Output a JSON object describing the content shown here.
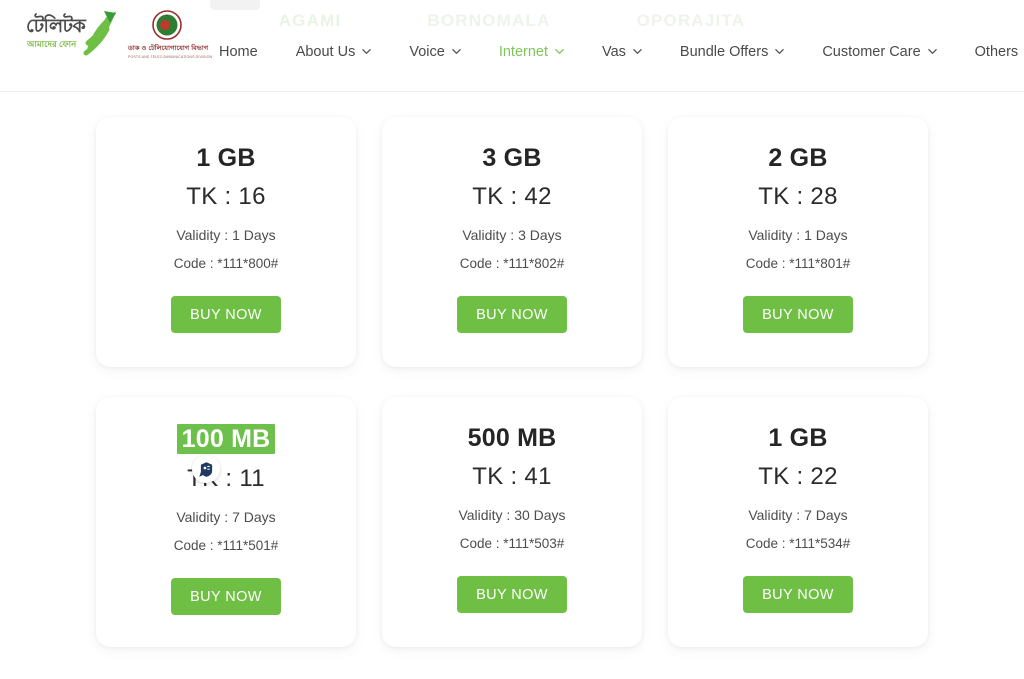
{
  "header": {
    "logo": {
      "brand_name_bn": "টেলিটক",
      "brand_tagline_bn": "আমাদের ফোন",
      "brand_icon": "teletalk-swoosh-icon"
    },
    "gov_logo": {
      "seal_icon": "bangladesh-government-seal-icon",
      "department_bn": "ডাক ও টেলিযোগাযোগ বিভাগ",
      "department_en": "POSTS AND TELECOMMUNICATIONS DIVISION"
    },
    "watermark": [
      "AGAMI",
      "BORNOMALA",
      "OPORAJITA"
    ],
    "nav": [
      {
        "label": "Home",
        "has_caret": false,
        "active": false
      },
      {
        "label": "About Us",
        "has_caret": true,
        "active": false
      },
      {
        "label": "Voice",
        "has_caret": true,
        "active": false
      },
      {
        "label": "Internet",
        "has_caret": true,
        "active": true
      },
      {
        "label": "Vas",
        "has_caret": true,
        "active": false
      },
      {
        "label": "Bundle Offers",
        "has_caret": true,
        "active": false
      },
      {
        "label": "Customer Care",
        "has_caret": true,
        "active": false
      },
      {
        "label": "Others",
        "has_caret": true,
        "active": false
      }
    ]
  },
  "colors": {
    "accent_green": "#6fbf44",
    "active_nav_green": "#7fc55b",
    "selection_green": "#6ec04c",
    "badge_navy": "#1f3864",
    "text_dark": "#252525",
    "card_bg": "#ffffff"
  },
  "packages": [
    {
      "size": "1 GB",
      "price": "TK : 16",
      "validity": "Validity : 1 Days",
      "code": "Code : *111*800#",
      "buy_label": "BUY NOW",
      "selected": false,
      "badge": null
    },
    {
      "size": "3 GB",
      "price": "TK : 42",
      "validity": "Validity : 3 Days",
      "code": "Code : *111*802#",
      "buy_label": "BUY NOW",
      "selected": false,
      "badge": null
    },
    {
      "size": "2 GB",
      "price": "TK : 28",
      "validity": "Validity : 1 Days",
      "code": "Code : *111*801#",
      "buy_label": "BUY NOW",
      "selected": false,
      "badge": null
    },
    {
      "size": "100 MB",
      "price": "TK : 11",
      "validity": "Validity : 7 Days",
      "code": "Code : *111*501#",
      "buy_label": "BUY NOW",
      "selected": true,
      "badge": "browser-extension-badge-icon"
    },
    {
      "size": "500 MB",
      "price": "TK : 41",
      "validity": "Validity : 30 Days",
      "code": "Code : *111*503#",
      "buy_label": "BUY NOW",
      "selected": false,
      "badge": null
    },
    {
      "size": "1 GB",
      "price": "TK : 22",
      "validity": "Validity : 7 Days",
      "code": "Code : *111*534#",
      "buy_label": "BUY NOW",
      "selected": false,
      "badge": null
    }
  ]
}
